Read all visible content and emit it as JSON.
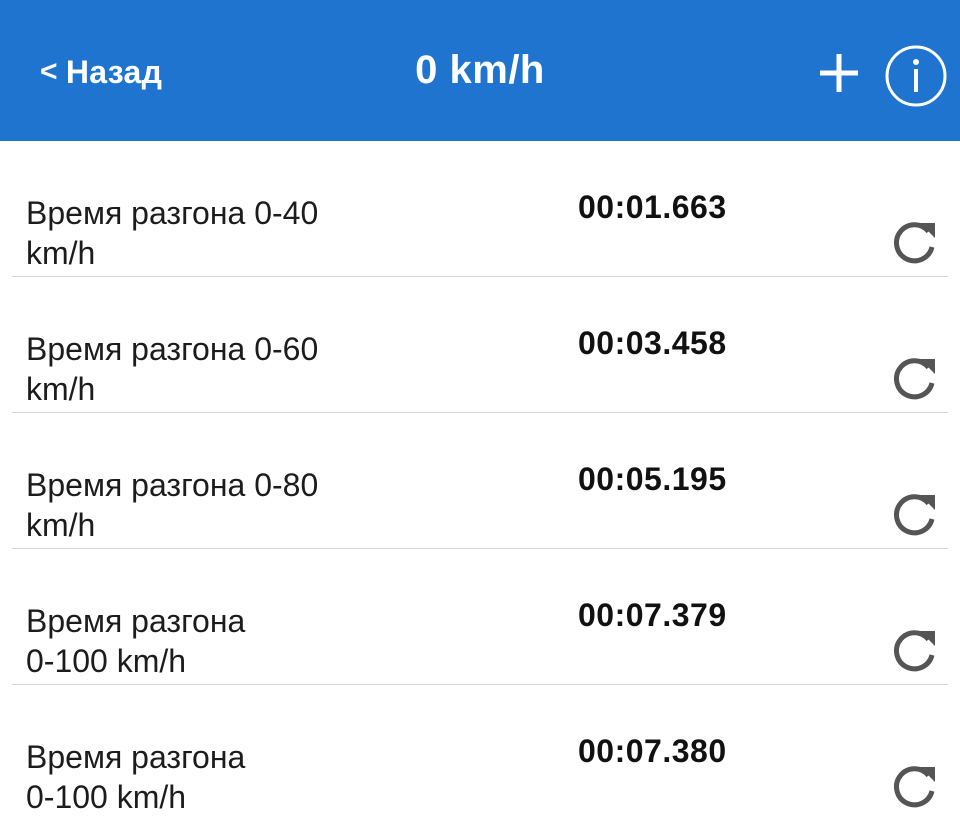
{
  "header": {
    "back_chevron": "<",
    "back_label": "Назад",
    "title": "0 km/h",
    "add_icon": "plus-icon",
    "info_icon": "info-icon"
  },
  "colors": {
    "header_bg": "#1f74cf",
    "header_text": "#ffffff",
    "divider": "#d4d4d4",
    "icon_gray": "#555555"
  },
  "rows": [
    {
      "label": "Время разгона  0-40\nkm/h",
      "value": "00:01.663",
      "action_icon": "refresh-icon"
    },
    {
      "label": "Время разгона  0-60\nkm/h",
      "value": "00:03.458",
      "action_icon": "refresh-icon"
    },
    {
      "label": "Время разгона  0-80\nkm/h",
      "value": "00:05.195",
      "action_icon": "refresh-icon"
    },
    {
      "label": "Время разгона\n0-100 km/h",
      "value": "00:07.379",
      "action_icon": "refresh-icon"
    },
    {
      "label": "Время разгона\n0-100 km/h",
      "value": "00:07.380",
      "action_icon": "refresh-icon"
    }
  ]
}
